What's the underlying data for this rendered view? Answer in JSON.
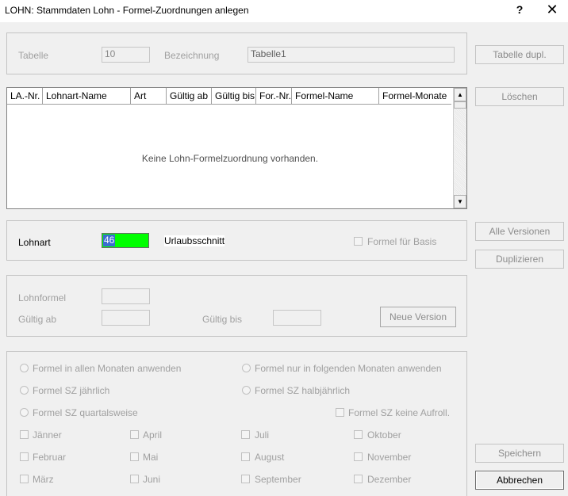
{
  "window": {
    "title": "LOHN: Stammdaten Lohn - Formel-Zuordnungen anlegen",
    "help_symbol": "?",
    "close_symbol": "✕"
  },
  "header": {
    "tabelle_label": "Tabelle",
    "tabelle_value": "10",
    "bezeichnung_label": "Bezeichnung",
    "bezeichnung_value": "Tabelle1"
  },
  "grid": {
    "columns": [
      "LA.-Nr.",
      "Lohnart-Name",
      "Art",
      "Gültig ab",
      "Gültig bis",
      "For.-Nr.",
      "Formel-Name",
      "Formel-Monate"
    ],
    "empty_message": "Keine Lohn-Formelzuordnung vorhanden."
  },
  "lohnart": {
    "label": "Lohnart",
    "value": "46",
    "name": "Urlaubsschnitt",
    "value_bg_color": "#00ff00",
    "formel_basis_label": "Formel für Basis"
  },
  "formel": {
    "lohnformel_label": "Lohnformel",
    "gueltig_ab_label": "Gültig ab",
    "gueltig_bis_label": "Gültig bis",
    "neue_version_label": "Neue Version"
  },
  "options": {
    "radio_alle_monate": "Formel in allen Monaten anwenden",
    "radio_folgende_monate": "Formel nur in folgenden Monaten anwenden",
    "radio_jaehrlich": "Formel SZ jährlich",
    "radio_halbjaehrlich": "Formel SZ halbjährlich",
    "radio_quartalsweise": "Formel SZ quartalsweise",
    "check_keine_aufroll": "Formel SZ keine Aufroll.",
    "months": [
      "Jänner",
      "April",
      "Juli",
      "Oktober",
      "Februar",
      "Mai",
      "August",
      "November",
      "März",
      "Juni",
      "September",
      "Dezember"
    ]
  },
  "buttons": {
    "tabelle_dupl": "Tabelle dupl.",
    "loeschen": "Löschen",
    "alle_versionen": "Alle Versionen",
    "duplizieren": "Duplizieren",
    "speichern": "Speichern",
    "abbrechen": "Abbrechen"
  }
}
